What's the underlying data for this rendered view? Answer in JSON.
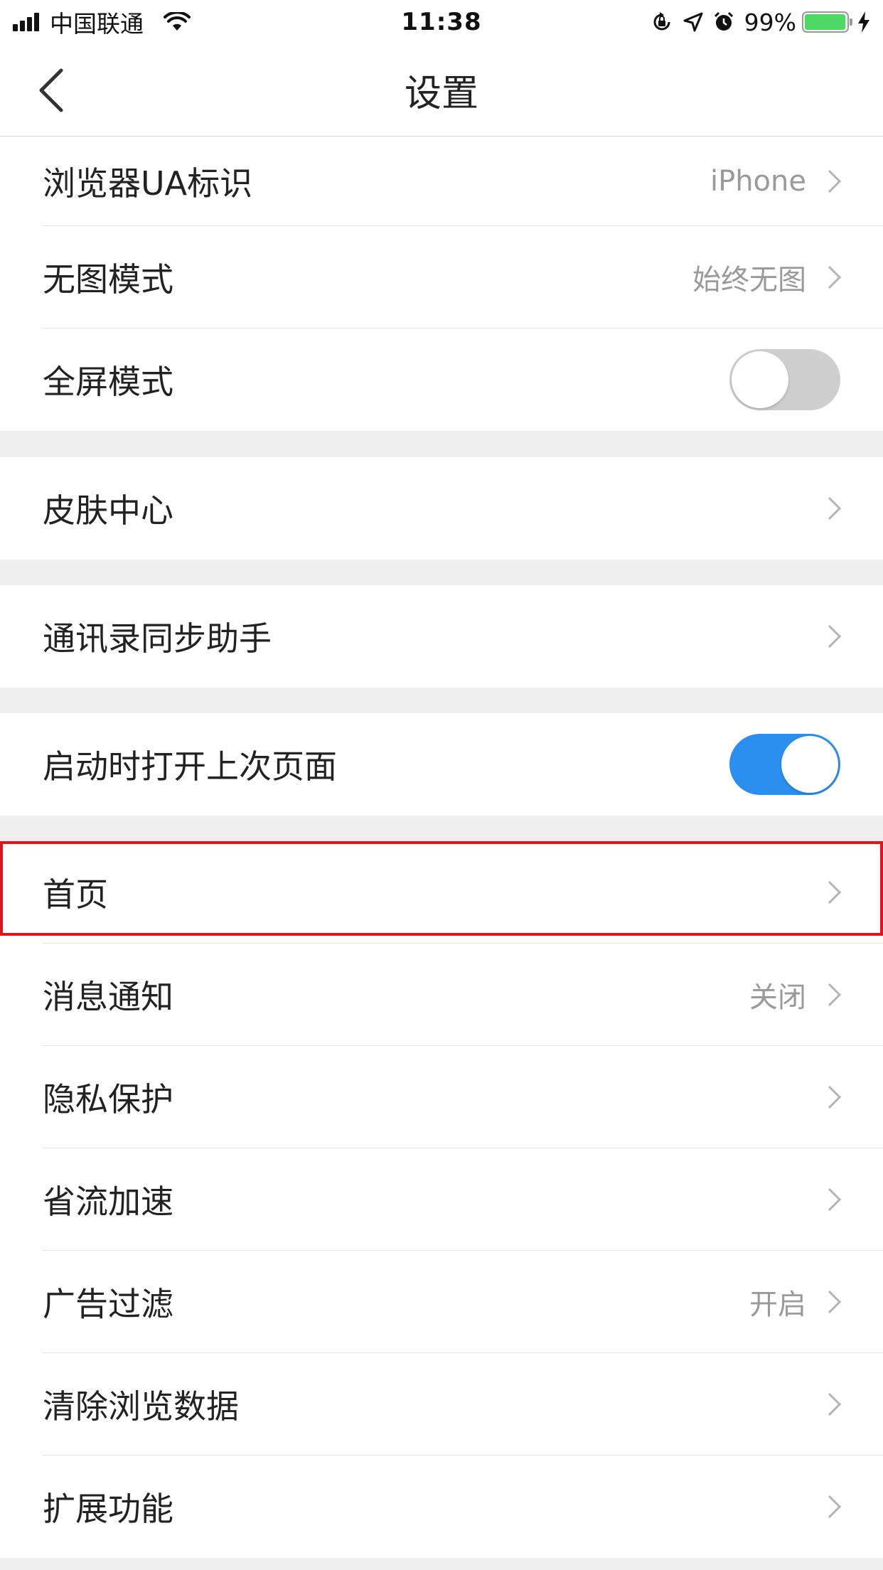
{
  "status_bar": {
    "carrier": "中国联通",
    "time": "11:38",
    "battery_percent": "99%",
    "battery_level": 0.99,
    "battery_color": "#4cd964"
  },
  "nav": {
    "title": "设置",
    "back_icon": "chevron-left-icon"
  },
  "settings": {
    "ua": {
      "label": "浏览器UA标识",
      "value": "iPhone"
    },
    "no_image": {
      "label": "无图模式",
      "value": "始终无图"
    },
    "fullscreen": {
      "label": "全屏模式",
      "toggle": "off"
    },
    "skin": {
      "label": "皮肤中心"
    },
    "contacts": {
      "label": "通讯录同步助手"
    },
    "restore": {
      "label": "启动时打开上次页面",
      "toggle": "on"
    },
    "homepage": {
      "label": "首页",
      "highlighted": true
    },
    "notifications": {
      "label": "消息通知",
      "value": "关闭"
    },
    "privacy": {
      "label": "隐私保护"
    },
    "data_saver": {
      "label": "省流加速"
    },
    "ad_filter": {
      "label": "广告过滤",
      "value": "开启"
    },
    "clear_data": {
      "label": "清除浏览数据"
    },
    "extensions": {
      "label": "扩展功能"
    }
  },
  "colors": {
    "toggle_on": "#2b8ff0",
    "toggle_off": "#cfcfcf",
    "highlight": "#e0141a"
  }
}
